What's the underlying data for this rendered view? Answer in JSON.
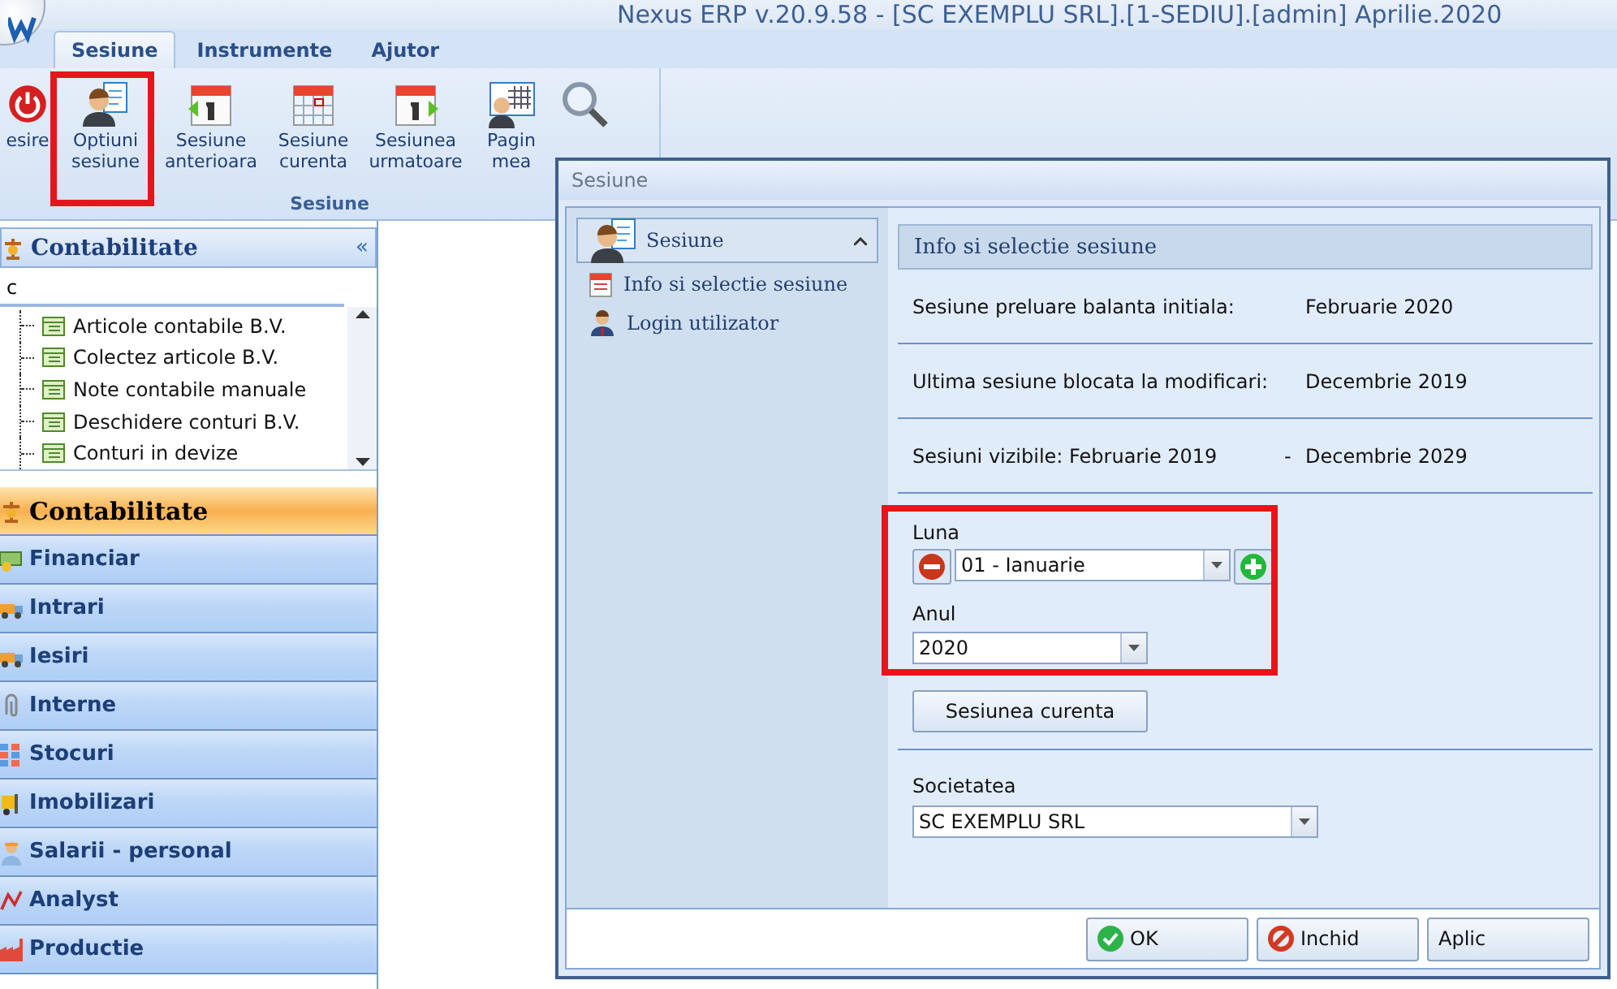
{
  "window": {
    "title": "Nexus ERP v.20.9.58 - [SC EXEMPLU SRL].[1-SEDIU].[admin] Aprilie.2020"
  },
  "menu_tabs": [
    {
      "label": "Sesiune",
      "selected": true
    },
    {
      "label": "Instrumente",
      "selected": false
    },
    {
      "label": "Ajutor",
      "selected": false
    }
  ],
  "ribbon": {
    "group_label": "Sesiune",
    "buttons": [
      {
        "lines": [
          "esire"
        ],
        "kind": "power"
      },
      {
        "lines": [
          "Optiuni",
          "sesiune"
        ],
        "kind": "person-doc"
      },
      {
        "lines": [
          "Sesiune",
          "anterioara"
        ],
        "kind": "calendar-prev"
      },
      {
        "lines": [
          "Sesiune",
          "curenta"
        ],
        "kind": "calendar-grid"
      },
      {
        "lines": [
          "Sesiunea",
          "urmatoare"
        ],
        "kind": "calendar-next"
      },
      {
        "lines": [
          "Pagin",
          "mea"
        ],
        "kind": "person-grid"
      },
      {
        "kind": "magnifier"
      }
    ]
  },
  "sidebar": {
    "header": "Contabilitate",
    "collapse_glyph": "«",
    "search": {
      "value": "c"
    },
    "tree_items": [
      "Articole contabile B.V.",
      "Colectez articole B.V.",
      "Note contabile manuale",
      "Deschidere conturi B.V.",
      "Conturi in devize"
    ],
    "nav": [
      {
        "label": "Contabilitate",
        "selected": true,
        "kind": "scales"
      },
      {
        "label": "Financiar",
        "selected": false,
        "kind": "money"
      },
      {
        "label": "Intrari",
        "selected": false,
        "kind": "truck"
      },
      {
        "label": "Iesiri",
        "selected": false,
        "kind": "truck"
      },
      {
        "label": "Interne",
        "selected": false,
        "kind": "clip"
      },
      {
        "label": "Stocuri",
        "selected": false,
        "kind": "grid"
      },
      {
        "label": "Imobilizari",
        "selected": false,
        "kind": "forklift"
      },
      {
        "label": "Salarii - personal",
        "selected": false,
        "kind": "worker"
      },
      {
        "label": "Analyst",
        "selected": false,
        "kind": "chart"
      },
      {
        "label": "Productie",
        "selected": false,
        "kind": "factory"
      }
    ]
  },
  "dialog": {
    "title": "Sesiune",
    "nav_group": {
      "label": "Sesiune",
      "expanded": true
    },
    "nav_items": [
      {
        "label": "Info si selectie sesiune",
        "kind": "calendar"
      },
      {
        "label": "Login utilizator",
        "kind": "user"
      }
    ],
    "panel_title": "Info si selectie sesiune",
    "info_rows": [
      {
        "label": "Sesiune preluare balanta initiala:",
        "value": "Februarie 2020"
      },
      {
        "label": "Ultima sesiune blocata la modificari:",
        "value": "Decembrie 2019"
      },
      {
        "label": "Sesiuni vizibile: Februarie 2019",
        "separator": "-",
        "value": "Decembrie 2029"
      }
    ],
    "month": {
      "label": "Luna",
      "value": "01 - Ianuarie"
    },
    "year": {
      "label": "Anul",
      "value": "2020"
    },
    "current_button": "Sesiunea curenta",
    "company": {
      "label": "Societatea",
      "value": "SC EXEMPLU SRL"
    },
    "buttons": [
      {
        "label": "OK",
        "kind": "ok"
      },
      {
        "label": "Inchid",
        "kind": "cancel"
      },
      {
        "label": "Aplic",
        "kind": "plain"
      }
    ]
  }
}
